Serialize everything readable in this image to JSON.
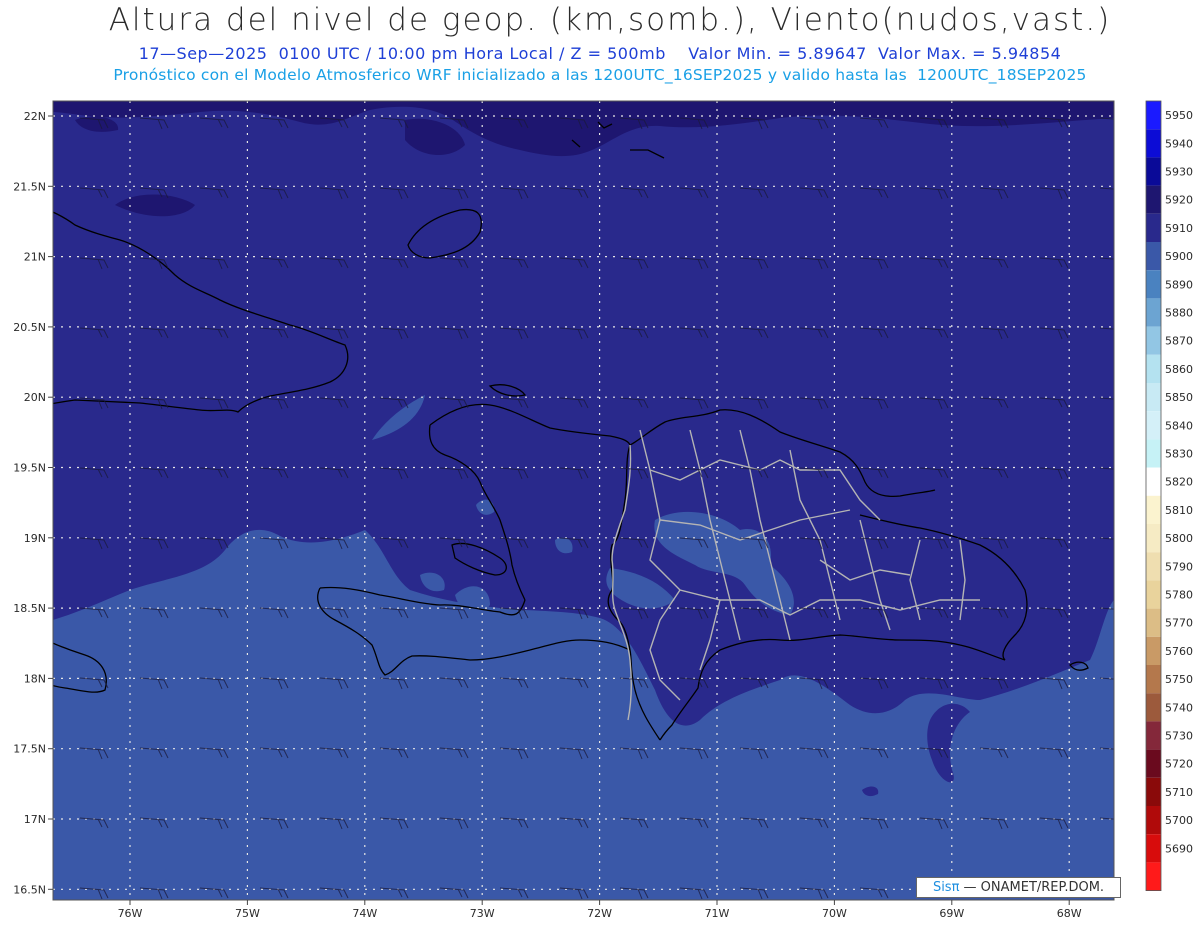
{
  "header": {
    "title": "Altura del nivel de geop. (km,somb.), Viento(nudos,vast.)",
    "subtitle_1": "17—Sep—2025  0100 UTC / 10:00 pm Hora Local / Z = 500mb    Valor Min. = 5.89647  Valor Max. = 5.94854",
    "subtitle_2": "Pronóstico con el Modelo Atmosferico WRF inicializado a las 1200UTC_16SEP2025 y valido hasta las  1200UTC_18SEP2025"
  },
  "map": {
    "lat_labels": [
      "22N",
      "21.5N",
      "21N",
      "20.5N",
      "20N",
      "19.5N",
      "19N",
      "18.5N",
      "18N",
      "17.5N",
      "17N",
      "16.5N"
    ],
    "lon_labels": [
      "76W",
      "75W",
      "74W",
      "73W",
      "72W",
      "71W",
      "70W",
      "69W",
      "68W"
    ],
    "colors": {
      "level_5920": "#1e1670",
      "level_5910": "#29298c",
      "level_5900": "#3a58a8",
      "coast": "#000000",
      "borders": "#b4b4b4",
      "grid": "#e6e6e6"
    }
  },
  "colorbar": {
    "levels": [
      {
        "label": "5950",
        "color": "#1a1aff"
      },
      {
        "label": "5940",
        "color": "#0c0cd6"
      },
      {
        "label": "5930",
        "color": "#0a0a98"
      },
      {
        "label": "5920",
        "color": "#1e1670"
      },
      {
        "label": "5910",
        "color": "#29298c"
      },
      {
        "label": "5900",
        "color": "#3a58a8"
      },
      {
        "label": "5890",
        "color": "#4a82c0"
      },
      {
        "label": "5880",
        "color": "#6ca4d2"
      },
      {
        "label": "5870",
        "color": "#92c6e4"
      },
      {
        "label": "5860",
        "color": "#b4e2f0"
      },
      {
        "label": "5850",
        "color": "#c8eaf4"
      },
      {
        "label": "5840",
        "color": "#d4f0f8"
      },
      {
        "label": "5830",
        "color": "#c6f2f6"
      },
      {
        "label": "5820",
        "color": "#ffffff"
      },
      {
        "label": "5810",
        "color": "#fbf3cf"
      },
      {
        "label": "5800",
        "color": "#f6ebc4"
      },
      {
        "label": "5790",
        "color": "#efdeb0"
      },
      {
        "label": "5780",
        "color": "#e9d39c"
      },
      {
        "label": "5770",
        "color": "#dcbd86"
      },
      {
        "label": "5760",
        "color": "#c99a66"
      },
      {
        "label": "5750",
        "color": "#b4784c"
      },
      {
        "label": "5740",
        "color": "#9c5a3c"
      },
      {
        "label": "5730",
        "color": "#84283a"
      },
      {
        "label": "5720",
        "color": "#6a0a1e"
      },
      {
        "label": "5710",
        "color": "#8a0a0a"
      },
      {
        "label": "5700",
        "color": "#b00a0a"
      },
      {
        "label": "5690",
        "color": "#d80c0c"
      },
      {
        "label": "",
        "color": "#ff1a1a"
      }
    ]
  },
  "credit": {
    "brand": "Sisπ",
    "text": " — ONAMET/REP.DOM."
  }
}
